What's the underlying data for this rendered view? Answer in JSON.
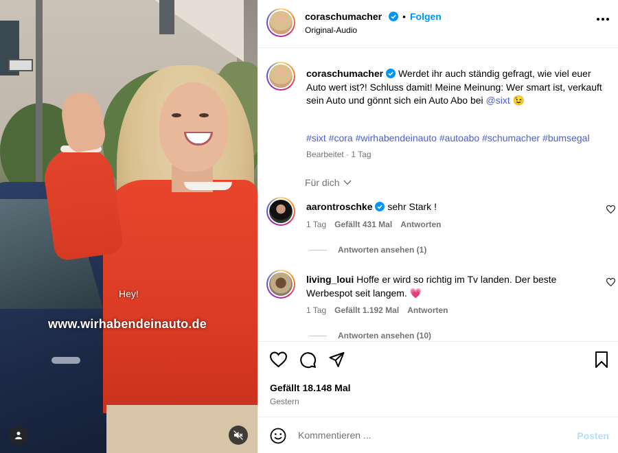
{
  "video": {
    "subtitle": "Hey!",
    "url_overlay": "www.wirhabendeinauto.de",
    "user_icon": "user-icon",
    "mute_icon": "muted-speaker-icon"
  },
  "header": {
    "username": "coraschumacher",
    "separator": "•",
    "follow_label": "Folgen",
    "audio": "Original-Audio",
    "more_icon": "more-horizontal-icon"
  },
  "caption": {
    "username": "coraschumacher",
    "text_part1": "Werdet ihr auch ständig gefragt, wie viel euer Auto wert ist?! Schluss damit! Meine Meinung: Wer smart ist, verkauft sein Auto und gönnt sich ein Auto Abo bei",
    "mention": "@sixt",
    "emoji": "😉",
    "hashtags": [
      "#sixt",
      "#cora",
      "#wirhabendeinauto",
      "#autoabo",
      "#schumacher",
      "#bumsegal"
    ],
    "edited": "Bearbeitet · 1 Tag"
  },
  "fuer_dich": "Für dich",
  "comments": [
    {
      "username": "aarontroschke",
      "verified": true,
      "text": "sehr Stark !",
      "time": "1 Tag",
      "likes": "Gefällt 431 Mal",
      "reply": "Antworten",
      "view_replies": "Antworten ansehen (1)"
    },
    {
      "username": "living_loui",
      "verified": false,
      "text": "Hoffe er wird so richtig im Tv landen. Der beste Werbespot seit langem.",
      "emoji": "💗",
      "time": "1 Tag",
      "likes": "Gefällt 1.192 Mal",
      "reply": "Antworten",
      "view_replies": "Antworten ansehen (10)"
    }
  ],
  "actions": {
    "like_icon": "heart-icon",
    "comment_icon": "comment-icon",
    "share_icon": "share-icon",
    "save_icon": "bookmark-icon",
    "likes": "Gefällt 18.148 Mal",
    "date": "Gestern"
  },
  "comment_box": {
    "placeholder": "Kommentieren ...",
    "post_label": "Posten",
    "emoji_icon": "smiley-icon"
  },
  "colors": {
    "link": "#4a5cd6",
    "follow": "#0095f6",
    "verified": "#0095f6",
    "muted_text": "#737373",
    "post_disabled": "#b2dffc",
    "reply_heart": "#ff3040"
  }
}
